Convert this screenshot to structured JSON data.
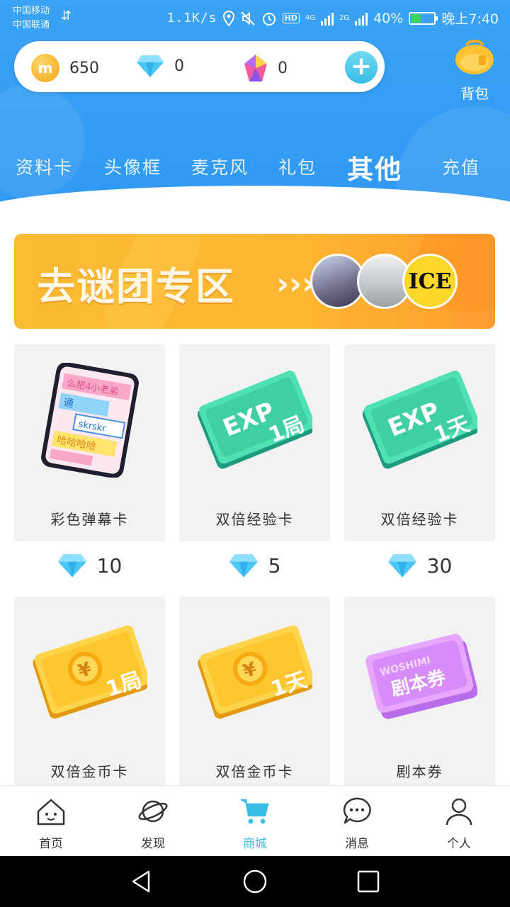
{
  "status_bar": {
    "carrier_1": "中国移动",
    "carrier_2": "中国联通",
    "speed": "1.1K/s",
    "hd": "HD",
    "net1": "4G",
    "net2": "2G",
    "battery": "40%",
    "time": "晚上7:40"
  },
  "wallet": {
    "coins": "650",
    "coin_symbol": "m",
    "diamonds": "0",
    "crystals": "0"
  },
  "backpack_label": "背包",
  "tabs": [
    {
      "label": "资料卡"
    },
    {
      "label": "头像框"
    },
    {
      "label": "麦克风"
    },
    {
      "label": "礼包"
    },
    {
      "label": "其他",
      "active": true
    },
    {
      "label": "充值"
    }
  ],
  "banner": {
    "text": "去谜团专区",
    "arrow": "›››",
    "avatar3_text": "ICE"
  },
  "products": [
    {
      "name": "彩色弹幕卡",
      "price": "10",
      "icon": "danmaku-card-icon"
    },
    {
      "name": "双倍经验卡",
      "price": "5",
      "icon": "exp-card-1-round-icon"
    },
    {
      "name": "双倍经验卡",
      "price": "30",
      "icon": "exp-card-1-day-icon"
    },
    {
      "name": "双倍金币卡",
      "icon": "coin-card-1-round-icon"
    },
    {
      "name": "双倍金币卡",
      "icon": "coin-card-1-day-icon"
    },
    {
      "name": "剧本券",
      "icon": "script-ticket-icon"
    }
  ],
  "art_text": {
    "exp": "EXP",
    "round": "1局",
    "day": "1天",
    "yuan": "¥",
    "ticket_brand": "WOSHIMI",
    "ticket_label": "剧本券",
    "danmaku_lines": [
      "么肥4小老弟",
      "通",
      "skrskr",
      "哈哈哈哈"
    ]
  },
  "bottom_nav": [
    {
      "label": "首页",
      "icon": "home-icon"
    },
    {
      "label": "发现",
      "icon": "planet-icon"
    },
    {
      "label": "商城",
      "icon": "cart-icon",
      "active": true
    },
    {
      "label": "消息",
      "icon": "chat-icon"
    },
    {
      "label": "个人",
      "icon": "person-icon"
    }
  ],
  "colors": {
    "header_blue": "#2f98f2",
    "accent_cyan": "#3cbde6",
    "banner_orange": "#ffb631"
  }
}
